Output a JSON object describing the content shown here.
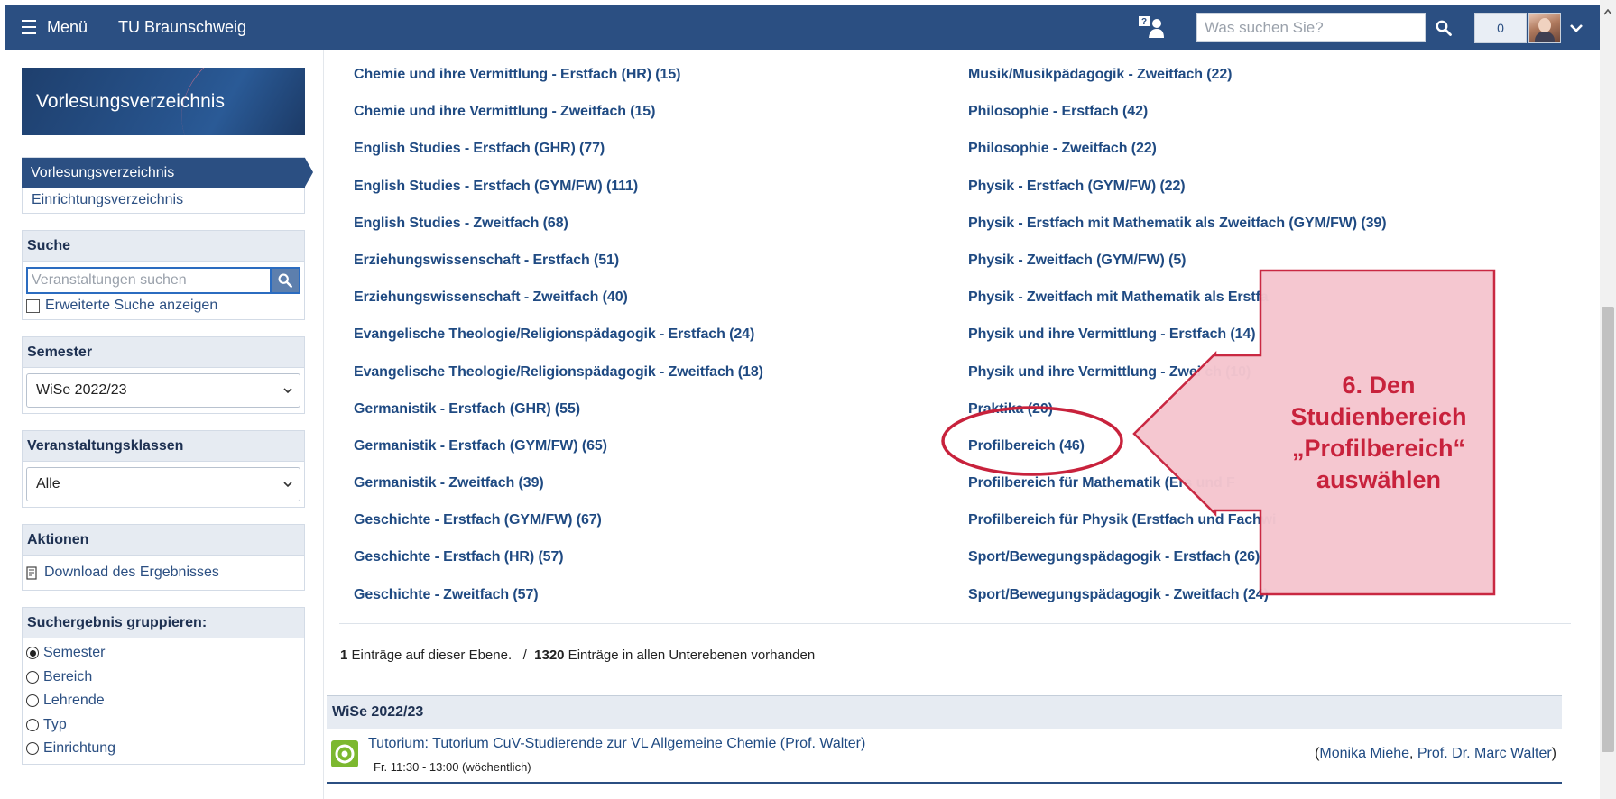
{
  "topbar": {
    "menu_label": "Menü",
    "brand": "TU Braunschweig",
    "search_placeholder": "Was suchen Sie?",
    "counter": "0"
  },
  "sidebar": {
    "banner_title": "Vorlesungsverzeichnis",
    "nav_active": "Vorlesungsverzeichnis",
    "nav_link": "Einrichtungsverzeichnis",
    "search": {
      "heading": "Suche",
      "placeholder": "Veranstaltungen suchen",
      "advanced_label": "Erweiterte Suche anzeigen"
    },
    "semester": {
      "heading": "Semester",
      "selected": "WiSe 2022/23"
    },
    "classes": {
      "heading": "Veranstaltungsklassen",
      "selected": "Alle"
    },
    "actions": {
      "heading": "Aktionen",
      "download_label": "Download des Ergebnisses"
    },
    "grouping": {
      "heading": "Suchergebnis gruppieren:",
      "options": [
        "Semester",
        "Bereich",
        "Lehrende",
        "Typ",
        "Einrichtung"
      ],
      "selected": "Semester"
    }
  },
  "main": {
    "left_column": [
      "Chemie und ihre Vermittlung - Erstfach (HR) (15)",
      "Chemie und ihre Vermittlung - Zweitfach (15)",
      "English Studies - Erstfach (GHR) (77)",
      "English Studies - Erstfach (GYM/FW) (111)",
      "English Studies - Zweitfach (68)",
      "Erziehungswissenschaft - Erstfach (51)",
      "Erziehungswissenschaft - Zweitfach (40)",
      "Evangelische Theologie/Religionspädagogik - Erstfach (24)",
      "Evangelische Theologie/Religionspädagogik - Zweitfach (18)",
      "Germanistik - Erstfach (GHR) (55)",
      "Germanistik - Erstfach (GYM/FW) (65)",
      "Germanistik - Zweitfach (39)",
      "Geschichte - Erstfach (GYM/FW) (67)",
      "Geschichte - Erstfach (HR) (57)",
      "Geschichte - Zweitfach (57)"
    ],
    "right_column": [
      "Musik/Musikpädagogik - Zweitfach (22)",
      "Philosophie - Erstfach (42)",
      "Philosophie - Zweitfach (22)",
      "Physik - Erstfach (GYM/FW) (22)",
      "Physik - Erstfach mit Mathematik als Zweitfach (GYM/FW) (39)",
      "Physik - Zweitfach (GYM/FW) (5)",
      "Physik - Zweitfach mit Mathematik als Erstfa",
      "Physik und ihre Vermittlung - Erstfach (14)",
      "Physik und ihre Vermittlung - Zwei ch (10)",
      "Praktika (20)",
      "Profilbereich (46)",
      "Profilbereich für Mathematik (Ers   und F",
      "Profilbereich für Physik (Erstfach und Fachwi",
      "Sport/Bewegungspädagogik - Erstfach (26)",
      "Sport/Bewegungspädagogik - Zweitfach (24)"
    ],
    "summary": {
      "level_count": "1",
      "level_text": " Einträge auf dieser Ebene.   /  ",
      "total_count": "1320",
      "total_text": " Einträge in allen Unterebenen vorhanden"
    },
    "result": {
      "semester_heading": "WiSe 2022/23",
      "title": "Tutorium: Tutorium CuV-Studierende zur VL Allgemeine Chemie (Prof. Walter)",
      "time": "Fr. 11:30 - 13:00 (wöchentlich)",
      "lecturer_1": "Monika Miehe",
      "lecturer_2": "Prof. Dr. Marc Walter"
    }
  },
  "annotation": {
    "lines": [
      "6. Den",
      "Studienbereich",
      "„Profilbereich“",
      "auswählen"
    ],
    "highlight_color": "#c8223c",
    "fill_color": "#f5c6cf"
  }
}
